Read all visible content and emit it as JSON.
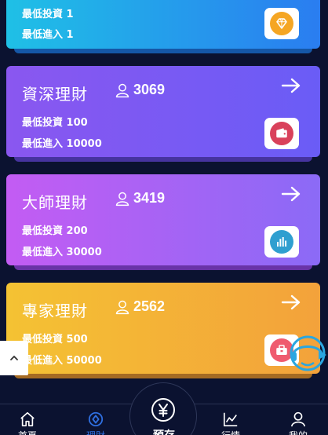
{
  "cards": [
    {
      "title": "",
      "count": "",
      "line1": "最低投資 1",
      "line2": "最低進入 1",
      "icon": "diamond-icon",
      "gradient_from": "#1fc0e6",
      "gradient_to": "#2a7df0",
      "badge_color": "#f5a623"
    },
    {
      "title": "資深理財",
      "count": "3069",
      "line1": "最低投資 100",
      "line2": "最低進入 10000",
      "icon": "wallet-icon",
      "gradient_from": "#8a57f0",
      "gradient_to": "#6a5cf6",
      "badge_color": "#d9415b"
    },
    {
      "title": "大師理財",
      "count": "3419",
      "line1": "最低投資 200",
      "line2": "最低進入 30000",
      "icon": "bar-chart-icon",
      "gradient_from": "#c35cf3",
      "gradient_to": "#8b6af6",
      "badge_color": "#2f9fd0"
    },
    {
      "title": "專家理財",
      "count": "2562",
      "line1": "最低投資 500",
      "line2": "最低進入 50000",
      "icon": "bag-icon",
      "gradient_from": "#f4c233",
      "gradient_to": "#f3a23b",
      "badge_color": "#ef5b6f"
    }
  ],
  "tabs": [
    {
      "label": "首頁",
      "icon": "home-icon"
    },
    {
      "label": "理財",
      "icon": "compass-icon"
    },
    {
      "label": "預存",
      "icon": "yen-icon"
    },
    {
      "label": "行情",
      "icon": "chart-line-icon"
    },
    {
      "label": "我的",
      "icon": "user-icon"
    }
  ],
  "colors": {
    "background": "#0b1230",
    "active_tab": "#2f6fe0"
  }
}
